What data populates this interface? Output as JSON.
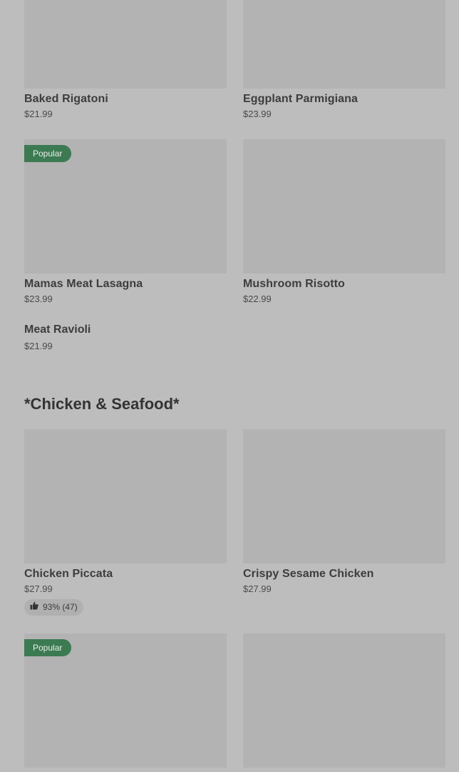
{
  "menu": {
    "row1": [
      {
        "name": "Baked Rigatoni",
        "price": "$21.99"
      },
      {
        "name": "Eggplant Parmigiana",
        "price": "$23.99"
      }
    ],
    "row2": [
      {
        "name": "Mamas Meat Lasagna",
        "price": "$23.99",
        "badge": "Popular"
      },
      {
        "name": "Mushroom Risotto",
        "price": "$22.99"
      }
    ],
    "text_item": {
      "name": "Meat Ravioli",
      "price": "$21.99"
    },
    "section_title": "*Chicken & Seafood*",
    "row3": [
      {
        "name": "Chicken Piccata",
        "price": "$27.99",
        "rating": "93% (47)"
      },
      {
        "name": "Crispy Sesame Chicken",
        "price": "$27.99"
      }
    ],
    "row4": [
      {
        "badge": "Popular"
      }
    ]
  },
  "colors": {
    "background": "#bdbdbd",
    "image_placeholder": "#b3b3b3",
    "badge": "#3c7a52"
  },
  "icons": {
    "rating": "thumbs-up-icon"
  }
}
